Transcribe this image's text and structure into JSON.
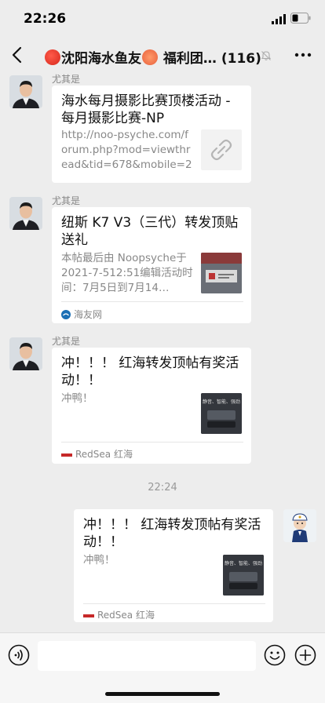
{
  "status_bar": {
    "time": "22:26"
  },
  "header": {
    "title_part1": "沈阳海水鱼友",
    "title_part2": "福利团…",
    "member_count": "(116)"
  },
  "messages": [
    {
      "sender": "尤其是",
      "title": "海水每月摄影比赛顶楼活动 - 每月摄影比赛-NP",
      "desc": "http://noo-psyche.com/forum.php?mod=viewthread&tid=678&mobile=2",
      "thumb_icon": "link-icon"
    },
    {
      "sender": "尤其是",
      "title": "纽斯 K7 V3（三代）转发顶贴送礼",
      "desc": "本帖最后由 Noopsyche于 2021-7-512:51编辑活动时间：7月5日到7月14…",
      "source": "海友网"
    },
    {
      "sender": "尤其是",
      "title": "冲！！！ 红海转发顶帖有奖活动！！",
      "desc": "冲鸭！",
      "source": "RedSea 红海",
      "thumb_text": "静音、智能、强劲"
    }
  ],
  "time_separator": "22:24",
  "self_message": {
    "title": "冲！！！ 红海转发顶帖有奖活动！！",
    "desc": "冲鸭！",
    "source": "RedSea 红海",
    "thumb_text": "静音、智能、强劲"
  },
  "colors": {
    "background": "#ededed",
    "card": "#ffffff",
    "muted_text": "#888888"
  }
}
